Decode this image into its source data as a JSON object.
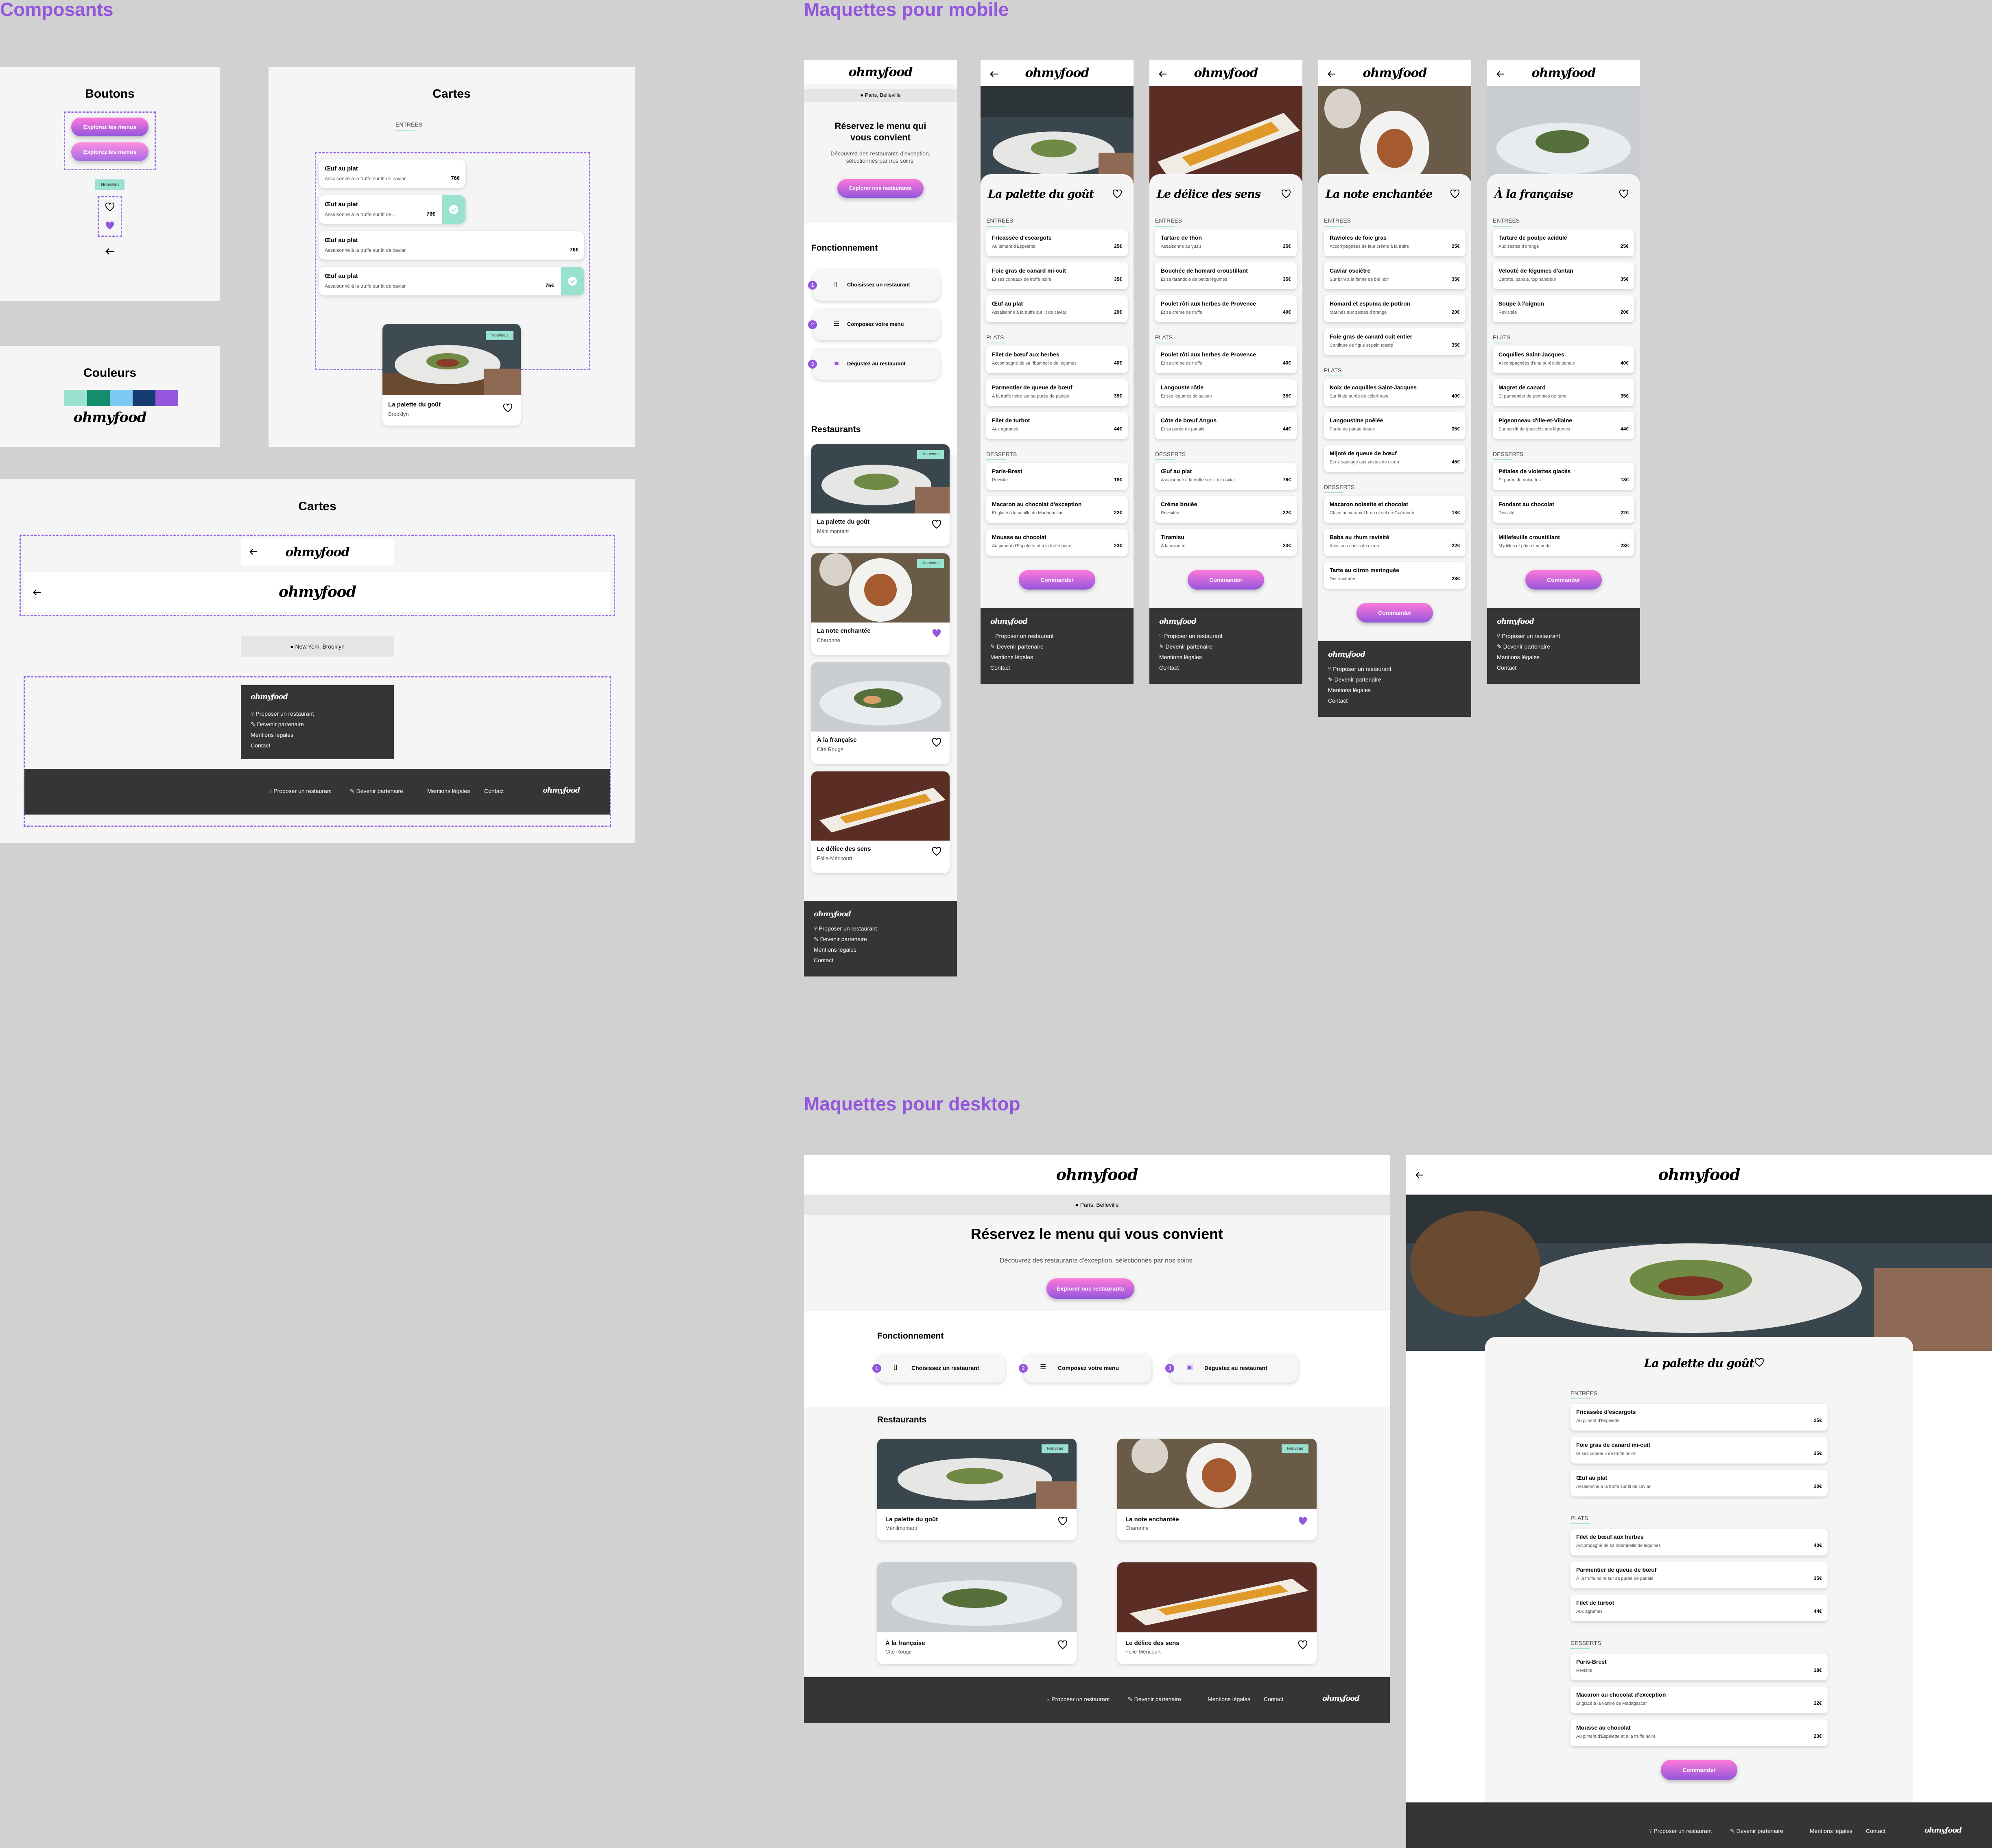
{
  "sections": {
    "components": "Composants",
    "mobile": "Maquettes pour mobile",
    "desktop": "Maquettes pour desktop"
  },
  "brand": {
    "logo": "ohmyfood",
    "primary": "#9356dc",
    "secondary": "#ff79da",
    "tertiary": "#99e2d0",
    "dark": "#353535"
  },
  "components": {
    "buttons_title": "Boutons",
    "button_label": "Explorez les menus",
    "badge": "Nouveau",
    "colors_title": "Couleurs",
    "palette": [
      "#99e2d0",
      "#138d6e",
      "#7ec8f5",
      "#143c6e",
      "#9356dc"
    ],
    "cards_title": "Cartes",
    "cards_section": "ENTRÉES",
    "dish_cards": [
      {
        "name": "Œuf au plat",
        "desc": "Assaisonné à la truffe sur lit de caviar",
        "price": "76€"
      },
      {
        "name": "Œuf au plat",
        "desc": "Assaisonné à la truffe sur lit de...",
        "price": "76€"
      },
      {
        "name": "Œuf au plat",
        "desc": "Assaisonné à la truffe sur lit de caviar",
        "price": "76€"
      },
      {
        "name": "Œuf au plat",
        "desc": "Assaisonné à la truffe sur lit de caviar",
        "price": "76€"
      }
    ],
    "sample_restaurant": {
      "name": "La palette du goût",
      "area": "Brooklyn"
    },
    "cards2_title": "Cartes",
    "location": "New York, Brooklyn"
  },
  "footer": {
    "propose": "Proposer un restaurant",
    "partner": "Devenir partenaire",
    "legal": "Mentions légales",
    "contact": "Contact"
  },
  "home": {
    "location": "Paris, Belleville",
    "hero_title_mobile": [
      "Réservez le menu qui",
      "vous convient"
    ],
    "hero_sub_mobile": [
      "Découvrez des restaurants d'exception,",
      "sélectionnés par nos soins."
    ],
    "hero_title": "Réservez le menu qui vous convient",
    "hero_sub": "Découvrez des restaurants d'exception, sélectionnés par nos soins.",
    "cta": "Explorer nos restaurants",
    "how_title": "Fonctionnement",
    "steps": [
      {
        "n": "1",
        "label": "Choisissez un restaurant"
      },
      {
        "n": "2",
        "label": "Composez votre menu"
      },
      {
        "n": "3",
        "label": "Dégustez au restaurant"
      }
    ],
    "restaurants_title": "Restaurants",
    "restaurants": [
      {
        "name": "La palette du goût",
        "area": "Ménilmontant",
        "new": true,
        "liked": false
      },
      {
        "name": "La note enchantée",
        "area": "Charonne",
        "new": true,
        "liked": true
      },
      {
        "name": "À la française",
        "area": "Cité Rouge",
        "new": false,
        "liked": false
      },
      {
        "name": "Le délice des sens",
        "area": "Folie-Méricourt",
        "new": false,
        "liked": false
      }
    ]
  },
  "order": "Commander",
  "menus": [
    {
      "name": "La palette du goût",
      "sections": [
        {
          "title": "ENTRÉES",
          "items": [
            [
              "Fricassée d'escargots",
              "Au piment d'Espelette",
              "25€"
            ],
            [
              "Foie gras de canard mi-cuit",
              "Et ses copeaux de truffe noire",
              "35€"
            ],
            [
              "Œuf au plat",
              "Assaisonné à la truffe sur lit de caviar",
              "20€"
            ]
          ]
        },
        {
          "title": "PLATS",
          "items": [
            [
              "Filet de bœuf aux herbes",
              "Accompagné de sa ribambelle de légumes",
              "40€"
            ],
            [
              "Parmentier de queue de bœuf",
              "À la truffe noire sur sa purée de panais",
              "35€"
            ],
            [
              "Filet de turbot",
              "Aux agrumes",
              "44€"
            ]
          ]
        },
        {
          "title": "DESSERTS",
          "items": [
            [
              "Paris-Brest",
              "Revisité",
              "18€"
            ],
            [
              "Macaron au chocolat d'exception",
              "Et glacé à la vanille de Madagascar",
              "22€"
            ],
            [
              "Mousse au chocolat",
              "Au piment d'Espelette et à la truffe noire",
              "23€"
            ]
          ]
        }
      ]
    },
    {
      "name": "Le délice des sens",
      "sections": [
        {
          "title": "ENTRÉES",
          "items": [
            [
              "Tartare de thon",
              "Assaisonné au yuzu",
              "25€"
            ],
            [
              "Bouchée de homard croustillant",
              "Et sa farandole de petits légumes",
              "35€"
            ],
            [
              "Poulet rôti aux herbes de Provence",
              "Et sa crème de truffe",
              "40€"
            ]
          ]
        },
        {
          "title": "PLATS",
          "items": [
            [
              "Poulet rôti aux herbes de Provence",
              "Et sa crème de truffe",
              "40€"
            ],
            [
              "Langouste rôtie",
              "Et ses légumes de saison",
              "35€"
            ],
            [
              "Côte de bœuf Angus",
              "Et sa purée de panais",
              "44€"
            ]
          ]
        },
        {
          "title": "DESSERTS",
          "items": [
            [
              "Œuf au plat",
              "Assaisonné à la truffe sur lit de caviar",
              "76€"
            ],
            [
              "Crème brulée",
              "Revisitée",
              "22€"
            ],
            [
              "Tiramisu",
              "À la noisette",
              "23€"
            ]
          ]
        }
      ]
    },
    {
      "name": "La note enchantée",
      "sections": [
        {
          "title": "ENTRÉES",
          "items": [
            [
              "Ravioles de foie gras",
              "Accompagnées de leur crème à la truffe",
              "25€"
            ],
            [
              "Caviar osciètre",
              "Sur blini à la farine de blé noir",
              "35€"
            ],
            [
              "Homard et espuma de potiron",
              "Marinés aux zestes d'orange",
              "20€"
            ],
            [
              "Foie gras de canard cuit entier",
              "Confiture de figue et pain toasté",
              "35€"
            ]
          ]
        },
        {
          "title": "PLATS",
          "items": [
            [
              "Noix de coquilles Saint-Jacques",
              "Sur lit de purée de céleri-rave",
              "40€"
            ],
            [
              "Langoustine poêlée",
              "Purée de patate douce",
              "35€"
            ],
            [
              "Mijoté de queue de bœuf",
              "Et riz sauvage aux zestes de citron",
              "45€"
            ]
          ]
        },
        {
          "title": "DESSERTS",
          "items": [
            [
              "Macaron noisette et chocolat",
              "Glace au caramel brun et sel de Guérande",
              "18€"
            ],
            [
              "Baba au rhum revisité",
              "Avec son coulis de citron",
              "22€"
            ],
            [
              "Tarte au citron meringuée",
              "Déstructurée",
              "23€"
            ]
          ]
        }
      ]
    },
    {
      "name": "À la française",
      "sections": [
        {
          "title": "ENTRÉES",
          "items": [
            [
              "Tartare de poulpe acidulé",
              "Aux zestes d'orange",
              "25€"
            ],
            [
              "Velouté de légumes d'antan",
              "Carotte, panais, topinambour",
              "35€"
            ],
            [
              "Soupe à l'oignon",
              "Revisitée",
              "20€"
            ]
          ]
        },
        {
          "title": "PLATS",
          "items": [
            [
              "Coquilles Saint-Jacques",
              "Accompagnées d'une purée de panais",
              "40€"
            ],
            [
              "Magret de canard",
              "Et parmentier de pommes de terre",
              "35€"
            ],
            [
              "Pigeonneau d'Ille-et-Vilaine",
              "Sur son lit de gnocchis aux légumes",
              "44€"
            ]
          ]
        },
        {
          "title": "DESSERTS",
          "items": [
            [
              "Pétales de violettes glacés",
              "Et purée de noisettes",
              "18€"
            ],
            [
              "Fondant au chocolat",
              "Revisité",
              "22€"
            ],
            [
              "Millefeuille croustillant",
              "Myrtilles et pâte d'amande",
              "23€"
            ]
          ]
        }
      ]
    }
  ]
}
